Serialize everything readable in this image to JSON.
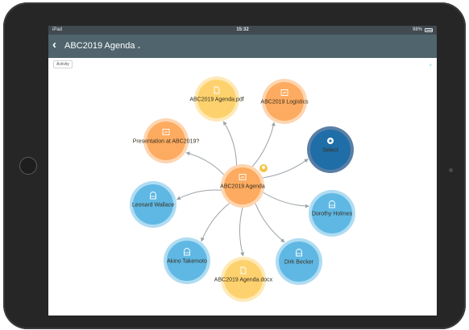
{
  "status_bar": {
    "device": "iPad",
    "time": "15:32",
    "battery": "98%"
  },
  "nav": {
    "back_icon": "chevron-left-icon",
    "title": "ABC2019 Agenda",
    "dropdown_icon": "chevron-down-icon"
  },
  "canvas": {
    "activity_label": "Activity"
  },
  "graph": {
    "center": {
      "label": "ABC2019 Agenda",
      "kind": "presentation",
      "badge": "bulb-icon"
    },
    "nodes": [
      {
        "label": "ABC2019 Agenda.pdf",
        "kind": "document"
      },
      {
        "label": "ABC2019 Logistics",
        "kind": "presentation"
      },
      {
        "label": "Presentation at ABC2019?",
        "kind": "presentation"
      },
      {
        "label": "Select",
        "kind": "select"
      },
      {
        "label": "Leonard Wallace",
        "kind": "person"
      },
      {
        "label": "Dorothy Holmes",
        "kind": "person"
      },
      {
        "label": "Akino Takemoto",
        "kind": "person"
      },
      {
        "label": "Dirk Becker",
        "kind": "person"
      },
      {
        "label": "ABC2019 Agenda.docx",
        "kind": "document"
      }
    ]
  },
  "colors": {
    "document": "#fdd26e",
    "presentation": "#fcab60",
    "person": "#5fb8e4",
    "select": "#1f6ea8",
    "nav_bar": "#4f646c",
    "edge": "#9aa3a8"
  }
}
